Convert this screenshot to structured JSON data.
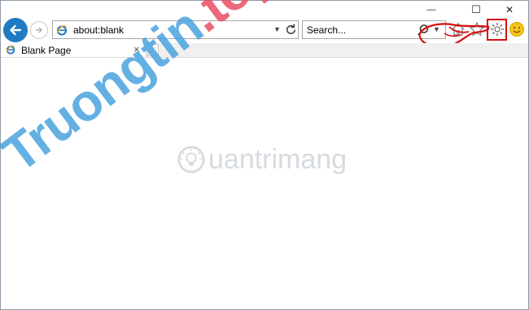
{
  "browser": {
    "address_url": "about:blank",
    "search_placeholder": "Search...",
    "tab_title": "Blank Page",
    "tab_close": "×"
  },
  "window_controls": {
    "minimize": "—",
    "maximize": "☐",
    "close": "✕"
  },
  "watermark": {
    "text": "Truongtin",
    "suffix": ".top"
  },
  "logo": {
    "text": "uantrimang"
  },
  "colors": {
    "back_button": "#1f7bc1",
    "annotation": "#d61010",
    "watermark": "#4aa3df",
    "watermark_suffix": "#e94f64"
  },
  "icons": [
    "arrow-left-icon",
    "arrow-right-icon",
    "ie-icon",
    "refresh-icon",
    "search-icon",
    "home-icon",
    "star-icon",
    "gear-icon",
    "smiley-icon"
  ]
}
